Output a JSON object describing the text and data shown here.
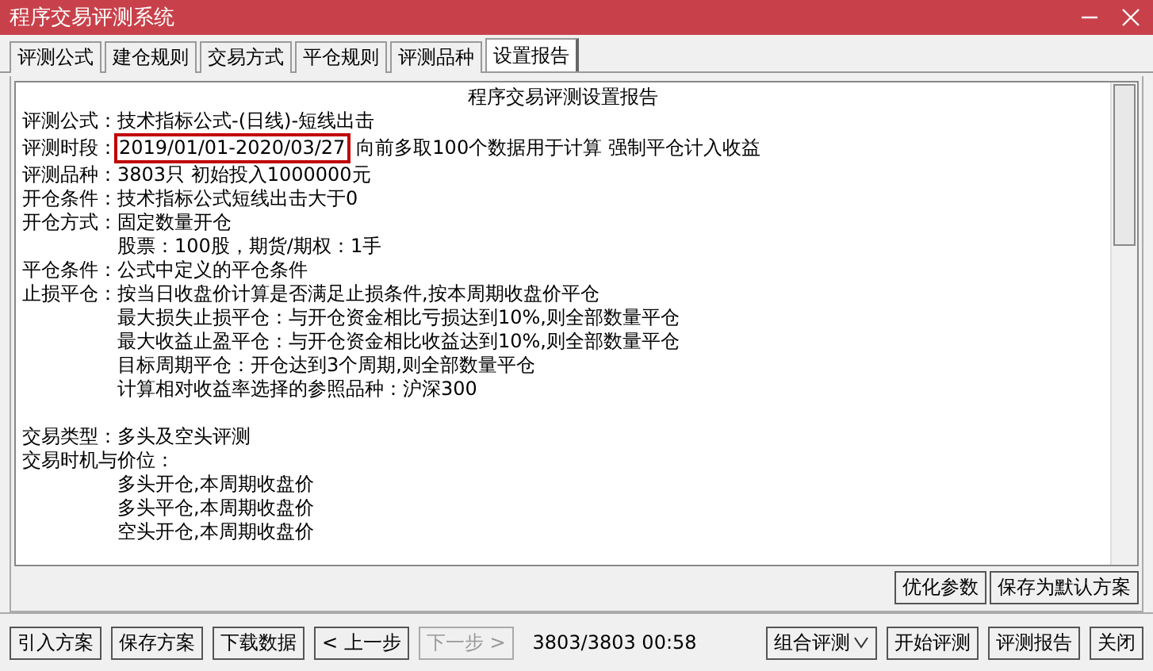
{
  "window": {
    "title": "程序交易评测系统",
    "controls": [
      {
        "kind": "minimize"
      },
      {
        "kind": "close"
      }
    ]
  },
  "tabs": [
    {
      "label": "评测公式",
      "selected": false
    },
    {
      "label": "建仓规则",
      "selected": false
    },
    {
      "label": "交易方式",
      "selected": false
    },
    {
      "label": "平仓规则",
      "selected": false
    },
    {
      "label": "评测品种",
      "selected": false
    },
    {
      "label": "设置报告",
      "selected": true
    }
  ],
  "report": {
    "title": "程序交易评测设置报告",
    "lines": [
      {
        "kind": "field",
        "label": "评测公式：",
        "value": "技术指标公式-(日线)-短线出击"
      },
      {
        "kind": "field",
        "label": "评测时段：",
        "value": "2019/01/01-2020/03/27",
        "highlighted": true,
        "extra": "向前多取100个数据用于计算 强制平仓计入收益"
      },
      {
        "kind": "field",
        "label": "评测品种：",
        "value": "3803只 初始投入1000000元"
      },
      {
        "kind": "field",
        "label": "开仓条件：",
        "value": "技术指标公式短线出击大于0"
      },
      {
        "kind": "field",
        "label": "开仓方式：",
        "value": "固定数量开仓"
      },
      {
        "kind": "indent",
        "value": "股票：100股，期货/期权：1手"
      },
      {
        "kind": "field",
        "label": "平仓条件：",
        "value": "公式中定义的平仓条件"
      },
      {
        "kind": "field",
        "label": "止损平仓：",
        "value": "按当日收盘价计算是否满足止损条件,按本周期收盘价平仓"
      },
      {
        "kind": "indent",
        "value": "最大损失止损平仓：与开仓资金相比亏损达到10%,则全部数量平仓"
      },
      {
        "kind": "indent",
        "value": "最大收益止盈平仓：与开仓资金相比收益达到10%,则全部数量平仓"
      },
      {
        "kind": "indent",
        "value": "目标周期平仓：开仓达到3个周期,则全部数量平仓"
      },
      {
        "kind": "indent",
        "value": "计算相对收益率选择的参照品种：沪深300"
      },
      {
        "kind": "spacer"
      },
      {
        "kind": "field",
        "label": "交易类型：",
        "value": "多头及空头评测"
      },
      {
        "kind": "field",
        "label": "交易时机与价位："
      },
      {
        "kind": "indent",
        "value": "多头开仓,本周期收盘价"
      },
      {
        "kind": "indent",
        "value": "多头平仓,本周期收盘价"
      },
      {
        "kind": "indent",
        "value": "空头开仓,本周期收盘价"
      }
    ]
  },
  "panel_buttons": [
    "优化参数",
    "保存为默认方案"
  ],
  "toolbar": {
    "left": [
      {
        "label": "引入方案",
        "disabled": false
      },
      {
        "label": "保存方案",
        "disabled": false
      },
      {
        "label": "下载数据",
        "disabled": false
      },
      {
        "label": "< 上一步",
        "disabled": false
      },
      {
        "label": "下一步 >",
        "disabled": true
      }
    ],
    "status": "3803/3803  00:58",
    "right": [
      {
        "label": "组合评测",
        "kind": "dropdown"
      },
      {
        "label": "开始评测",
        "kind": "plain"
      },
      {
        "label": "评测报告",
        "kind": "plain"
      },
      {
        "label": "关闭",
        "kind": "plain"
      }
    ]
  }
}
